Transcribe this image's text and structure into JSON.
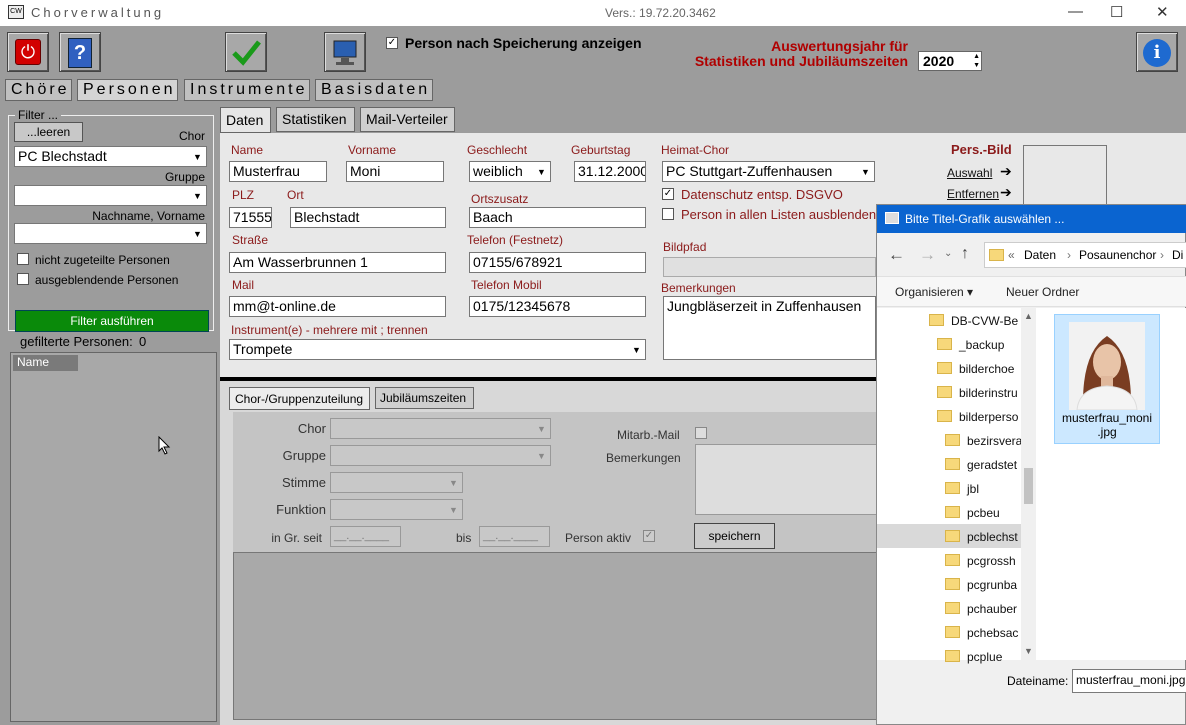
{
  "window": {
    "title": "Chorverwaltung",
    "version": "Vers.: 19.72.20.3462",
    "minimize": "—",
    "maximize": "☐",
    "close": "✕"
  },
  "toolbar": {
    "checkbox_label": "Person nach Speicherung anzeigen",
    "year_label_1": "Auswertungsjahr für",
    "year_label_2": "Statistiken und Jubiläumszeiten",
    "year_value": "2020",
    "info": "i"
  },
  "tabs": [
    "Chöre",
    "Personen",
    "Instrumente",
    "Basisdaten"
  ],
  "filter": {
    "title": "Filter ...",
    "clear": "...leeren",
    "chor_label": "Chor",
    "chor_value": "PC Blechstadt",
    "gruppe_label": "Gruppe",
    "name_label": "Nachname, Vorname",
    "cb1": "nicht zugeteilte Personen",
    "cb2": "ausgeblendende Personen",
    "run": "Filter ausführen",
    "count_label": "gefilterte Personen:",
    "count": "0",
    "col_name": "Name"
  },
  "subtabs": [
    "Daten",
    "Statistiken",
    "Mail-Verteiler"
  ],
  "person": {
    "name_label": "Name",
    "name": "Musterfrau",
    "vorname_label": "Vorname",
    "vorname": "Moni",
    "geschlecht_label": "Geschlecht",
    "geschlecht": "weiblich",
    "geburtstag_label": "Geburtstag",
    "geburtstag": "31.12.2000",
    "heimat_label": "Heimat-Chor",
    "heimat": "PC Stuttgart-Zuffenhausen",
    "dsgvo": "Datenschutz entsp. DSGVO",
    "ausblenden": "Person in allen Listen ausblenden",
    "plz_label": "PLZ",
    "plz": "71555",
    "ort_label": "Ort",
    "ort": "Blechstadt",
    "ortszusatz_label": "Ortszusatz",
    "ortszusatz": "Baach",
    "strasse_label": "Straße",
    "strasse": "Am Wasserbrunnen 1",
    "telefon_label": "Telefon (Festnetz)",
    "telefon": "07155/678921",
    "bildpfad_label": "Bildpfad",
    "mail_label": "Mail",
    "mail": "mm@t-online.de",
    "mobil_label": "Telefon Mobil",
    "mobil": "0175/12345678",
    "bemerk_label": "Bemerkungen",
    "bemerk": "Jungbläserzeit in Zuffenhausen",
    "instr_label": "Instrument(e) - mehrere mit ; trennen",
    "instr": "Trompete",
    "bild_title": "Pers.-Bild",
    "auswahl": "Auswahl",
    "entfernen": "Entfernen"
  },
  "lower": {
    "tab1": "Chor-/Gruppenzuteilung",
    "tab2": "Jubiläumszeiten",
    "chor": "Chor",
    "gruppe": "Gruppe",
    "stimme": "Stimme",
    "funktion": "Funktion",
    "seit": "in Gr. seit",
    "seit_val": "__.__.____",
    "bis": "bis",
    "bis_val": "__.__.____",
    "aktiv": "Person aktiv",
    "mitarb": "Mitarb.-Mail",
    "bemerk": "Bemerkungen",
    "save": "speichern"
  },
  "dialog": {
    "title": "Bitte Titel-Grafik auswählen ...",
    "path": [
      "«",
      "Daten",
      "›",
      "Posaunenchor",
      "›",
      "Di"
    ],
    "organize": "Organisieren ▾",
    "newfolder": "Neuer Ordner",
    "folders": [
      "DB-CVW-Be",
      "_backup",
      "bilderchoe",
      "bilderinstru",
      "bilderperso",
      "bezirsvera",
      "geradstet",
      "jbl",
      "pcbeu",
      "pcblechst",
      "pcgrossh",
      "pcgrunba",
      "pchauber",
      "pchebsac",
      "pcplue"
    ],
    "file": "musterfrau_moni.jpg",
    "file_line1": "musterfrau_moni",
    "file_line2": ".jpg",
    "filename_label": "Dateiname:",
    "filename": "musterfrau_moni.jpg"
  }
}
